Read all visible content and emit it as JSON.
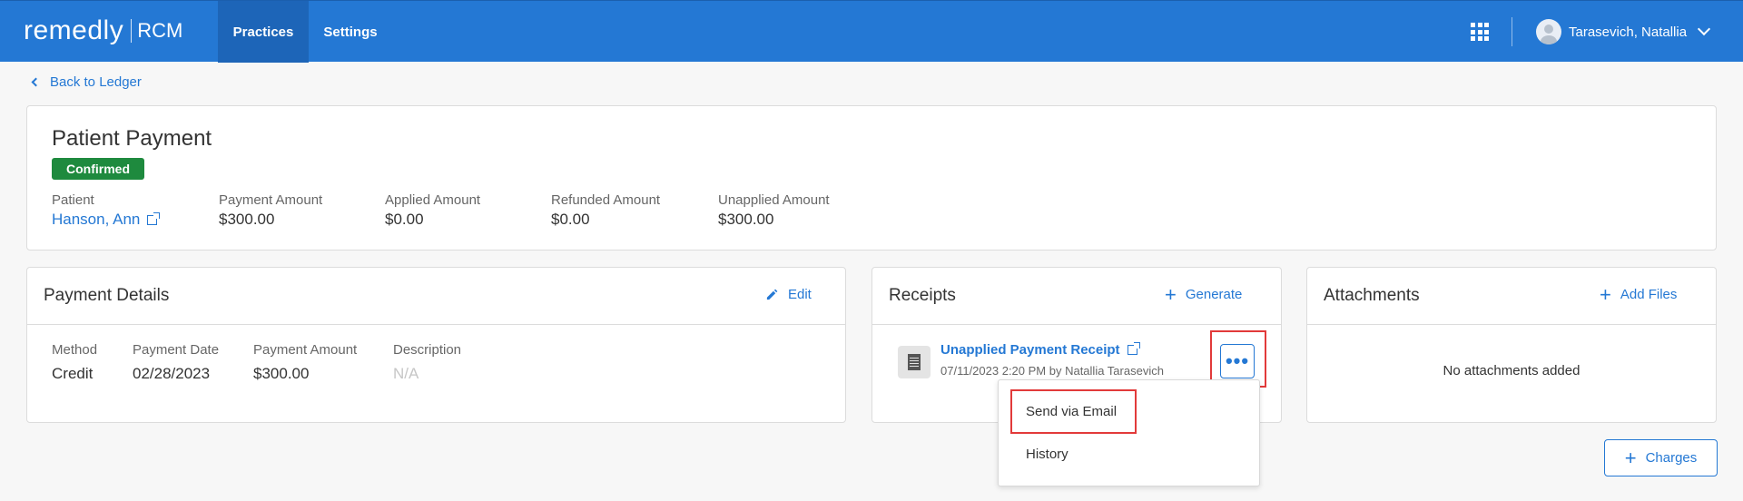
{
  "header": {
    "brand": "remedly",
    "brand_sub": "RCM",
    "tabs": [
      {
        "label": "Practices",
        "active": true
      },
      {
        "label": "Settings",
        "active": false
      }
    ],
    "apps_icon": "grid-icon",
    "user_name": "Tarasevich, Natallia",
    "accent_color": "#2478d4"
  },
  "back_link": "Back to Ledger",
  "payment": {
    "title": "Patient Payment",
    "status": "Confirmed",
    "status_color": "#1e8a3e",
    "fields": [
      {
        "label": "Patient",
        "value": "Hanson, Ann"
      },
      {
        "label": "Payment Amount",
        "value": "$300.00"
      },
      {
        "label": "Applied Amount",
        "value": "$0.00"
      },
      {
        "label": "Refunded Amount",
        "value": "$0.00"
      },
      {
        "label": "Unapplied Amount",
        "value": "$300.00"
      }
    ]
  },
  "details": {
    "title": "Payment Details",
    "edit_label": "Edit",
    "fields": [
      {
        "label": "Method",
        "value": "Credit"
      },
      {
        "label": "Payment Date",
        "value": "02/28/2023"
      },
      {
        "label": "Payment Amount",
        "value": "$300.00"
      },
      {
        "label": "Description",
        "value": "N/A"
      }
    ]
  },
  "receipts": {
    "title": "Receipts",
    "generate_label": "Generate",
    "items": [
      {
        "name": "Unapplied Payment Receipt",
        "meta": "07/11/2023 2:20 PM by Natallia Tarasevich"
      }
    ],
    "more_label": "•••"
  },
  "attachments": {
    "title": "Attachments",
    "add_label": "Add Files",
    "empty_text": "No attachments added"
  },
  "menu": {
    "items": [
      "Send via Email",
      "History"
    ]
  },
  "charges_label": "Charges"
}
